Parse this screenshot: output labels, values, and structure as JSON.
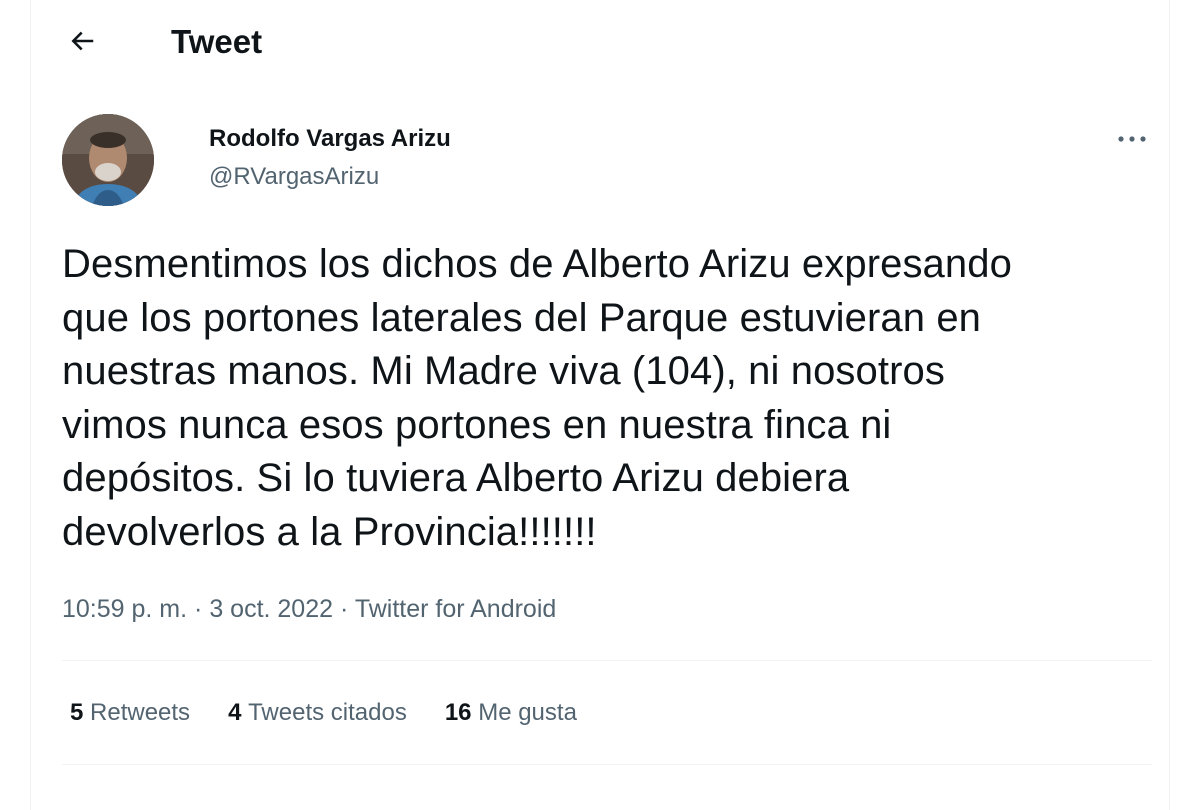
{
  "header": {
    "back_icon": "arrow-left-icon",
    "title": "Tweet"
  },
  "author": {
    "name": "Rodolfo Vargas Arizu",
    "handle": "@RVargasArizu",
    "more_icon": "more-horizontal-icon"
  },
  "tweet": {
    "text": "Desmentimos los dichos de Alberto Arizu expresando\nque los portones laterales del Parque estuvieran en\nnuestras manos. Mi Madre viva (104), ni nosotros\nvimos nunca esos portones en nuestra finca ni\ndepósitos. Si lo tuviera Alberto Arizu debiera\ndevolverlos a la Provincia!!!!!!!",
    "time": "10:59 p. m.",
    "date": "3 oct. 2022",
    "source": "Twitter for Android",
    "separator": "·"
  },
  "stats": {
    "retweets_count": "5",
    "retweets_label": "Retweets",
    "quotes_count": "4",
    "quotes_label": "Tweets citados",
    "likes_count": "16",
    "likes_label": "Me gusta"
  },
  "colors": {
    "text_primary": "#0f1419",
    "text_secondary": "#536471",
    "border": "#eff3f4"
  }
}
